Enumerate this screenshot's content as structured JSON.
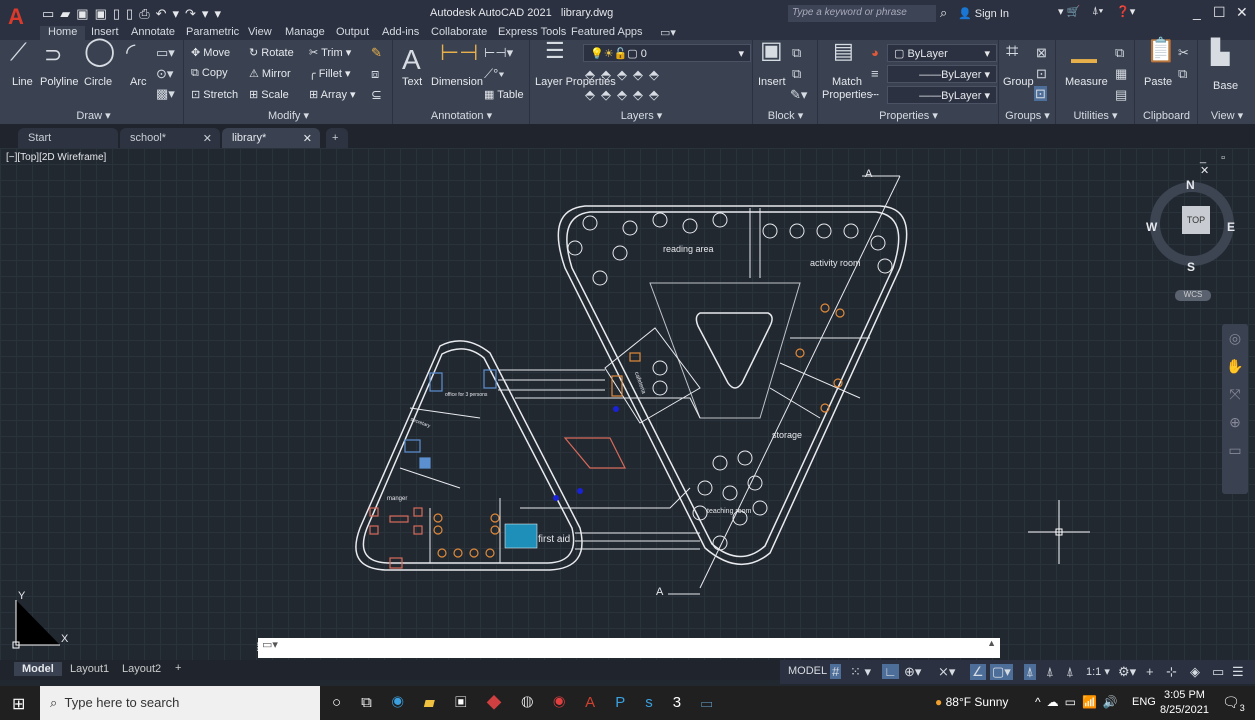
{
  "app": {
    "title": "Autodesk AutoCAD 2021",
    "file": "library.dwg",
    "search_placeholder": "Type a keyword or phrase",
    "sign_in": "Sign In"
  },
  "menu_tabs": [
    "Home",
    "Insert",
    "Annotate",
    "Parametric",
    "View",
    "Manage",
    "Output",
    "Add-ins",
    "Collaborate",
    "Express Tools",
    "Featured Apps"
  ],
  "ribbon": {
    "draw": {
      "title": "Draw",
      "items": [
        "Line",
        "Polyline",
        "Circle",
        "Arc"
      ]
    },
    "modify": {
      "title": "Modify",
      "items": [
        "Move",
        "Rotate",
        "Trim",
        "Copy",
        "Mirror",
        "Fillet",
        "Stretch",
        "Scale",
        "Array"
      ]
    },
    "annotation": {
      "title": "Annotation",
      "items": [
        "Text",
        "Dimension",
        "Table"
      ]
    },
    "layers": {
      "title": "Layers",
      "layer_properties": "Layer Properties",
      "current_layer": "0"
    },
    "block": {
      "title": "Block",
      "insert": "Insert"
    },
    "properties": {
      "title": "Properties",
      "match": "Match Properties",
      "color": "ByLayer",
      "linetype": "ByLayer",
      "lineweight": "ByLayer"
    },
    "groups": {
      "title": "Groups",
      "group": "Group"
    },
    "utilities": {
      "title": "Utilities",
      "measure": "Measure"
    },
    "clipboard": {
      "title": "Clipboard",
      "paste": "Paste"
    },
    "view": {
      "title": "View",
      "base": "Base"
    }
  },
  "doc_tabs": [
    {
      "label": "Start"
    },
    {
      "label": "school*"
    },
    {
      "label": "library*"
    }
  ],
  "viewport": {
    "label": "[−][Top][2D Wireframe]",
    "viewcube": {
      "n": "N",
      "s": "S",
      "e": "E",
      "w": "W",
      "top": "TOP",
      "wcs": "WCS"
    },
    "ucs": {
      "x": "X",
      "y": "Y"
    },
    "rooms": [
      "reading area",
      "activity room",
      "cafeteria",
      "storage",
      "teaching room",
      "office for 3 persons",
      "secretary",
      "manger",
      "first aid"
    ],
    "section_mark": "A"
  },
  "layout_tabs": [
    "Model",
    "Layout1",
    "Layout2"
  ],
  "status": {
    "model": "MODEL",
    "scale": "1:1"
  },
  "taskbar": {
    "search": "Type here to search",
    "weather": "88°F  Sunny",
    "lang": "ENG",
    "time": "3:05 PM",
    "date": "8/25/2021",
    "notifications": "3"
  }
}
